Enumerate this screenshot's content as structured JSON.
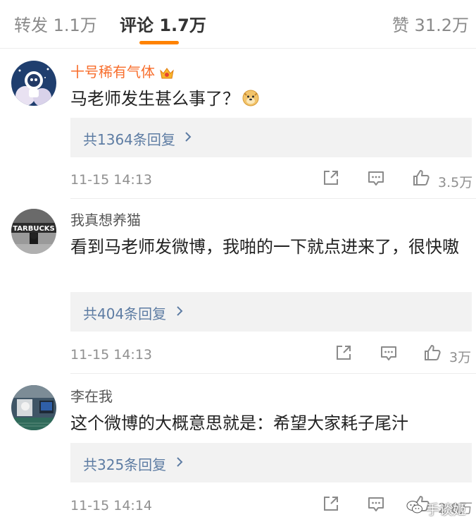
{
  "tabs": {
    "repost": "转发 1.1万",
    "comment": "评论 1.7万",
    "like": "赞 31.2万"
  },
  "colors": {
    "accent": "#ff8200",
    "vip_name": "#f86e2c",
    "link": "#5d7ca3",
    "reply_bg": "#f2f2f2"
  },
  "comments": [
    {
      "username": "十号稀有气体",
      "vip": true,
      "text": "马老师发生甚么事了？",
      "emoji": "doge",
      "replies": "共1364条回复",
      "time": "11-15 14:13",
      "likes": "3.5万"
    },
    {
      "username": "我真想养猫",
      "vip": false,
      "text": "看到马老师发微博，我啪的一下就点进来了，很快嗷",
      "replies": "共404条回复",
      "time": "11-15 14:13",
      "likes": "3万",
      "avatar_text": "TARBUCKS"
    },
    {
      "username": "李在我",
      "vip": false,
      "text": "这个微博的大概意思就是：希望大家耗子尾汁",
      "replies": "共325条回复",
      "time": "11-15 14:14",
      "likes": "2.8万"
    }
  ],
  "icons": {
    "repost": "share-out-icon",
    "comment": "comment-bubble-icon",
    "like": "thumbs-up-icon",
    "reply_arrow": "chevron-right-icon"
  },
  "watermark": "手谈姬"
}
